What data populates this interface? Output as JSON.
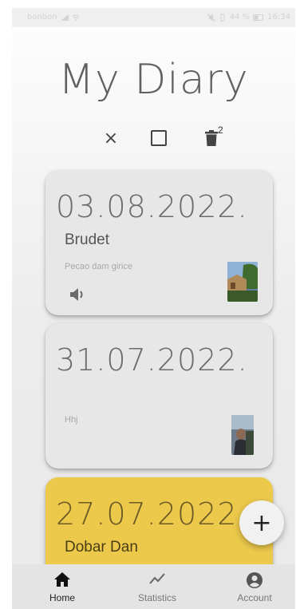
{
  "status_bar": {
    "carrier": "bonbon",
    "battery": "44 %",
    "time": "16:34"
  },
  "header": {
    "title": "My Diary"
  },
  "toolbar": {
    "icons": [
      "close-icon",
      "checkbox-icon",
      "delete-icon"
    ],
    "selected_count": "2"
  },
  "entries": [
    {
      "date": "03.08.2022.",
      "title": "Brudet",
      "text": "Pecao dam girice",
      "has_audio": true,
      "has_photo": true
    },
    {
      "date": "31.07.2022.",
      "title": "",
      "text": "Hhj",
      "has_audio": false,
      "has_photo": true
    },
    {
      "date": "27.07.2022.",
      "title": "Dobar Dan",
      "text": "",
      "has_audio": false,
      "has_photo": false
    }
  ],
  "colors": {
    "card_default": "#e7e7e7",
    "card_highlight": "#ecc94b"
  },
  "fab": {
    "label": "+"
  },
  "bottom_nav": {
    "items": [
      {
        "label": "Home",
        "icon": "home-icon",
        "active": true
      },
      {
        "label": "Statistics",
        "icon": "statistics-icon",
        "active": false
      },
      {
        "label": "Account",
        "icon": "account-icon",
        "active": false
      }
    ]
  }
}
